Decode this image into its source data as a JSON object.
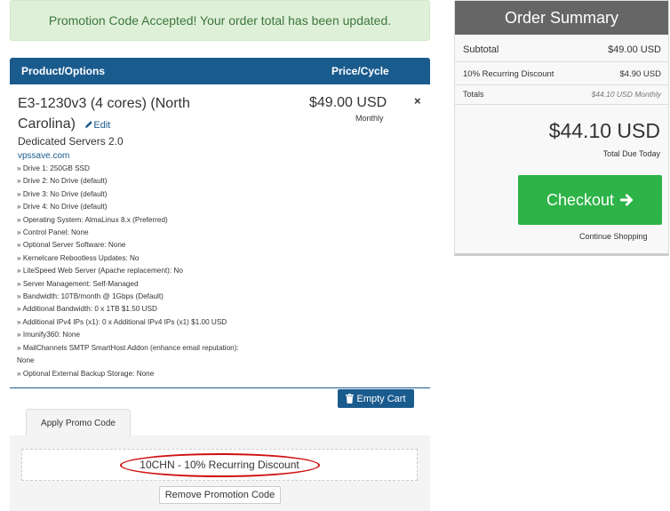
{
  "alert": {
    "message": "Promotion Code Accepted! Your order total has been updated."
  },
  "cart": {
    "header_product": "Product/Options",
    "header_price": "Price/Cycle",
    "item": {
      "title": "E3-1230v3 (4 cores) (North Carolina)",
      "edit_label": "Edit",
      "group": "Dedicated Servers 2.0",
      "domain": "vpssave.com",
      "price": "$49.00 USD",
      "cycle": "Monthly",
      "remove_symbol": "×",
      "options": [
        "» Drive 1: 250GB SSD",
        "» Drive 2: No Drive (default)",
        "» Drive 3: No Drive (default)",
        "» Drive 4: No Drive (default)",
        "» Operating System: AlmaLinux 8.x (Preferred)",
        "» Control Panel: None",
        "» Optional Server Software: None",
        "» Kernelcare Rebootless Updates: No",
        "» LiteSpeed Web Server (Apache replacement): No",
        "» Server Management: Self-Managed",
        "» Bandwidth: 10TB/month @ 1Gbps (Default)",
        "» Additional Bandwidth: 0 x 1TB $1.50 USD",
        "» Additional IPv4 IPs (x1): 0 x Additional IPv4 IPs (x1) $1.00 USD",
        "» Imunify360: None",
        "» MailChannels SMTP SmartHost Addon (enhance email reputation): None",
        "» Optional External Backup Storage: None"
      ]
    },
    "empty_cart_label": "Empty Cart"
  },
  "promo": {
    "tab_label": "Apply Promo Code",
    "applied_code": "10CHN - 10% Recurring Discount",
    "remove_label": "Remove Promotion Code",
    "highlight_color": "#d01010"
  },
  "summary": {
    "title": "Order Summary",
    "subtotal_label": "Subtotal",
    "subtotal_value": "$49.00 USD",
    "discount_label": "10% Recurring Discount",
    "discount_value": "$4.90 USD",
    "totals_label": "Totals",
    "totals_value": "$44.10 USD Monthly",
    "grand_total": "$44.10 USD",
    "due_today_label": "Total Due Today",
    "checkout_label": "Checkout",
    "continue_label": "Continue Shopping"
  },
  "colors": {
    "primary": "#1a5b8e",
    "success": "#2db347",
    "alert_bg": "#dff0d8",
    "alert_text": "#3c763d",
    "summary_header": "#666666"
  },
  "icons": {
    "edit": "pencil-icon",
    "remove": "close-icon",
    "empty_cart": "trash-icon",
    "checkout": "arrow-right-icon"
  }
}
